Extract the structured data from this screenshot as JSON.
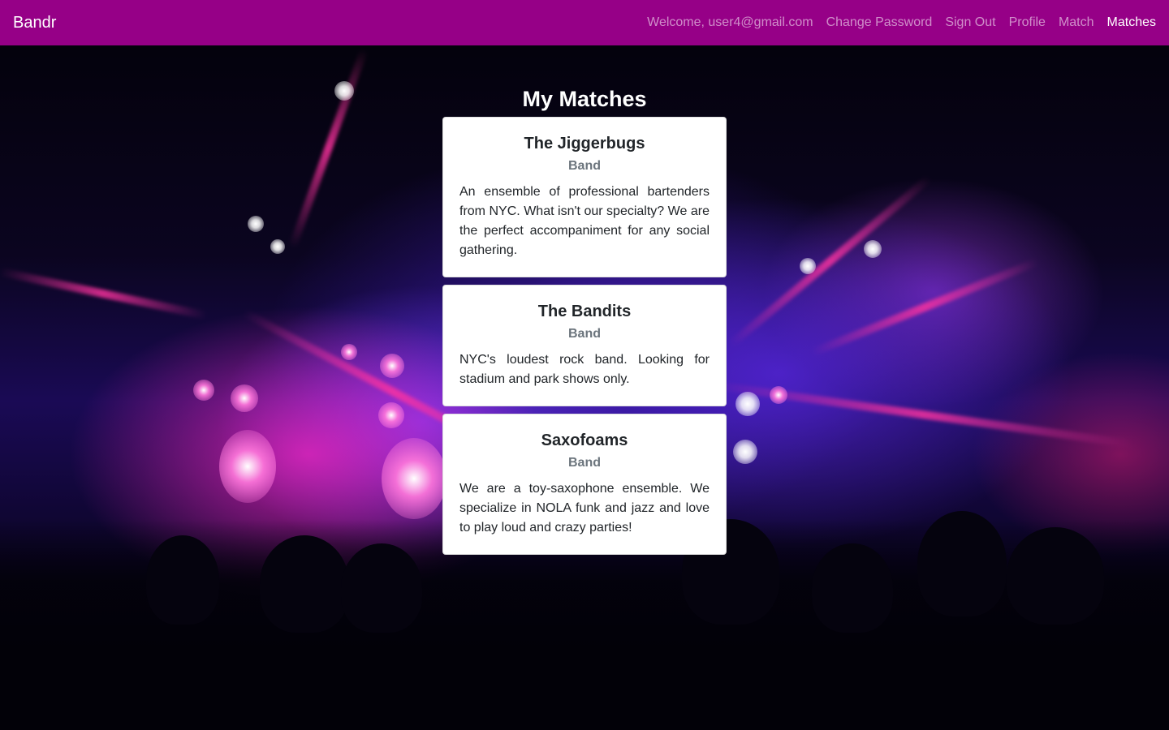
{
  "navbar": {
    "brand": "Bandr",
    "links": [
      {
        "label": "Welcome, user4@gmail.com"
      },
      {
        "label": "Change Password"
      },
      {
        "label": "Sign Out"
      },
      {
        "label": "Profile"
      },
      {
        "label": "Match"
      },
      {
        "label": "Matches"
      }
    ]
  },
  "main": {
    "title": "My Matches",
    "matches": [
      {
        "name": "The Jiggerbugs",
        "type": "Band",
        "description": "An ensemble of professional bartenders from NYC. What isn't our specialty? We are the perfect accompaniment for any social gathering."
      },
      {
        "name": "The Bandits",
        "type": "Band",
        "description": "NYC's loudest rock band. Looking for stadium and park shows only."
      },
      {
        "name": "Saxofoams",
        "type": "Band",
        "description": "We are a toy-saxophone ensemble. We specialize in NOLA funk and jazz and love to play loud and crazy parties!"
      }
    ]
  },
  "colors": {
    "navbar": "#960087",
    "card_bg": "#ffffff",
    "subtitle": "#6c757d"
  }
}
